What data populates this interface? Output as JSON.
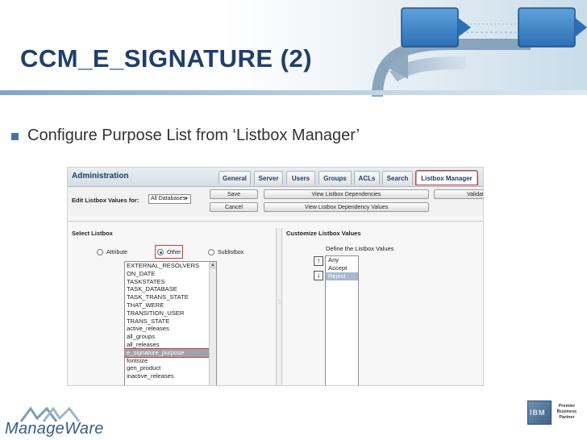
{
  "slide": {
    "title": "CCM_E_SIGNATURE (2)",
    "bullet": "Configure Purpose List from ‘Listbox Manager’"
  },
  "app": {
    "section_title": "Administration",
    "tabs": [
      {
        "label": "General",
        "active": false
      },
      {
        "label": "Server",
        "active": false
      },
      {
        "label": "Users",
        "active": false
      },
      {
        "label": "Groups",
        "active": false
      },
      {
        "label": "ACLs",
        "active": false
      },
      {
        "label": "Search",
        "active": false
      },
      {
        "label": "Listbox Manager",
        "active": true
      }
    ],
    "edit_label": "Edit Listbox Values for:",
    "db_select_value": "All Databases",
    "buttons": {
      "save": "Save",
      "cancel": "Cancel",
      "view_dependencies": "View Listbox Dependencies",
      "view_dependency_values": "View Listbox Dependency Values",
      "validate": "Validat"
    },
    "select_listbox": {
      "title": "Select Listbox",
      "radios": [
        {
          "label": "Attribute",
          "checked": false
        },
        {
          "label": "Other",
          "checked": true
        },
        {
          "label": "Sublistbox",
          "checked": false
        }
      ],
      "items": [
        "EXTERNAL_RESOLVERS",
        "ON_DATE",
        "TASKSTATES",
        "TASK_DATABASE",
        "TASK_TRANS_STATE",
        "THAT_WERE",
        "TRANSITION_USER",
        "TRANS_STATE",
        "active_releases",
        "all_groups",
        "all_releases",
        "e_signature_purpose",
        "fontsize",
        "gen_product",
        "inactive_releases"
      ],
      "selected_index": 11
    },
    "customize": {
      "title": "Customize Listbox Values",
      "define_label": "Define the Listbox Values",
      "values": [
        "Any",
        "Accept",
        "Reject"
      ],
      "selected_index": 2
    }
  },
  "footer": {
    "logo_text": "ManageWare",
    "partner_lines": [
      "Premier",
      "Business",
      "Partner"
    ],
    "ibm_letters": "IBM"
  },
  "colors": {
    "title": "#1f3f6b",
    "bullet": "#3d77a8",
    "highlight_border": "#d23b3b",
    "admin_title": "#1d3b66"
  }
}
